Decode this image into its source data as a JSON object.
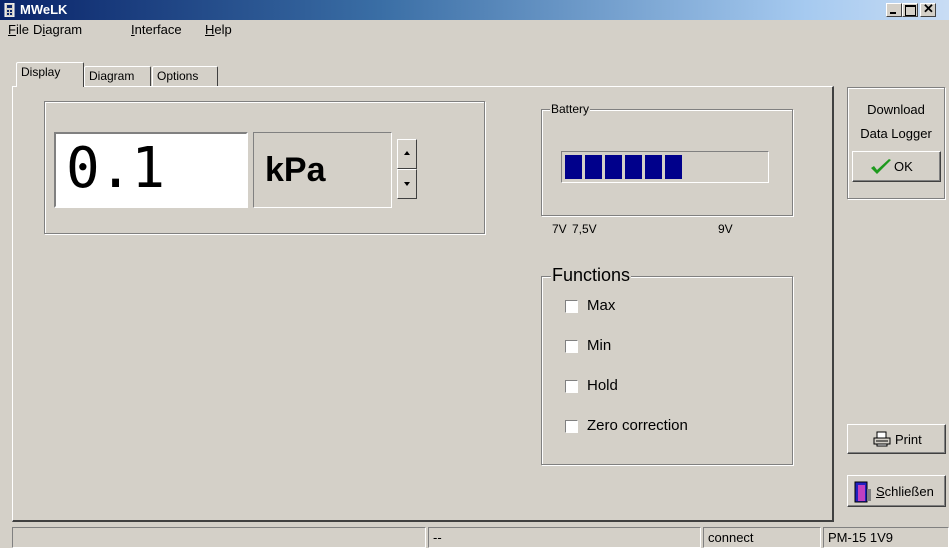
{
  "window": {
    "title": "MWeLK",
    "icon": "app-icon"
  },
  "menu": [
    {
      "pre": "",
      "key": "F",
      "post": "ile"
    },
    {
      "pre": "D",
      "key": "i",
      "post": "agram"
    },
    {
      "pre": "",
      "key": "I",
      "post": "nterface"
    },
    {
      "pre": "",
      "key": "H",
      "post": "elp"
    }
  ],
  "tabs": [
    "Display",
    "Diagram",
    "Options"
  ],
  "display": {
    "value": "0.1",
    "unit": "kPa"
  },
  "battery": {
    "label": "Battery",
    "segments_filled": 6,
    "ticks": [
      "7V",
      "7,5V",
      "9V"
    ],
    "color": "#00008b"
  },
  "functions": {
    "label": "Functions",
    "items": [
      {
        "label": "Max",
        "checked": false
      },
      {
        "label": "Min",
        "checked": false
      },
      {
        "label": "Hold",
        "checked": false
      },
      {
        "label": "Zero correction",
        "checked": false
      }
    ]
  },
  "right_panel": {
    "download_line1": "Download",
    "download_line2": "Data Logger",
    "ok_label": "OK",
    "print_label": "Print",
    "close_key": "S",
    "close_rest": "chließen"
  },
  "status": {
    "field1": "",
    "field2": "--",
    "field3": "connect",
    "field4": "PM-15  1V9"
  },
  "colors": {
    "titlebar_start": "#0a246a",
    "face": "#d4d0c8",
    "ok_check": "#1e9a1e"
  }
}
